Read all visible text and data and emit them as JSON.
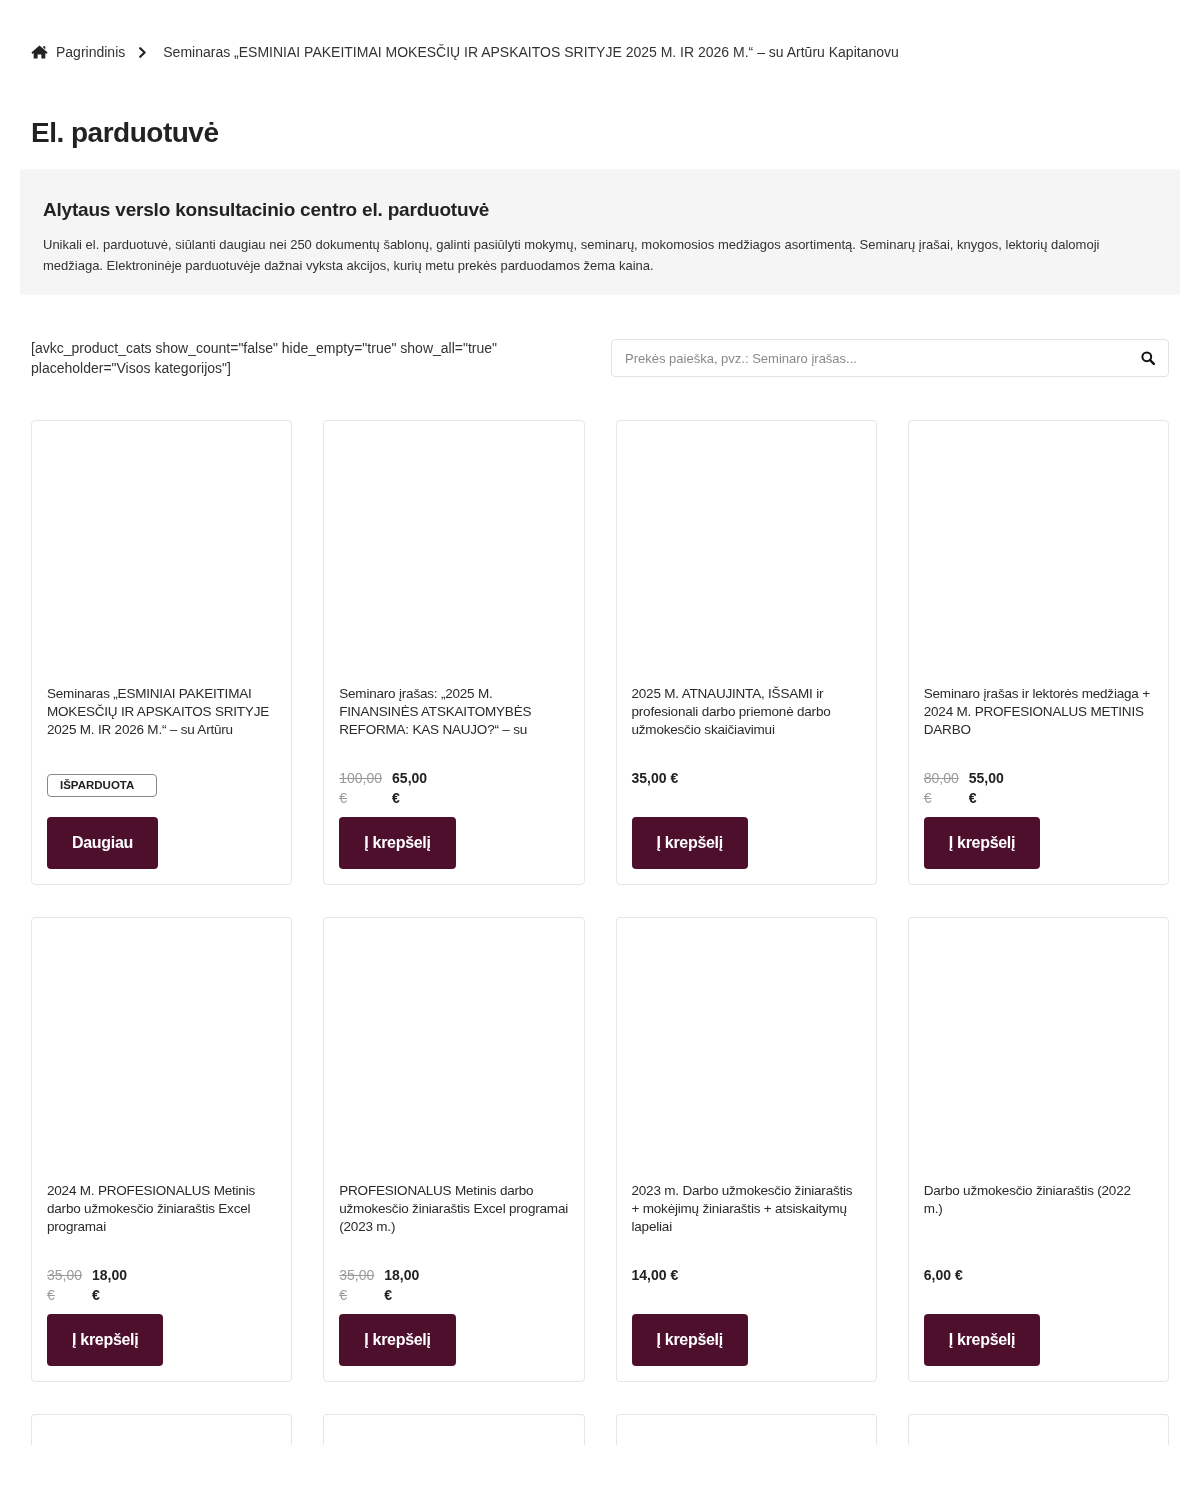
{
  "breadcrumb": [
    {
      "label": "Pagrindinis"
    },
    {
      "label": "Seminaras „ESMINIAI PAKEITIMAI MOKESČIŲ IR APSKAITOS SRITYJE 2025 M. IR 2026 M.“ – su Artūru Kapitanovu"
    }
  ],
  "page_title": "El. parduotuvė",
  "intro": {
    "heading": "Alytaus verslo konsultacinio centro el. parduotuvė",
    "text": "Unikali el. parduotuvė, siūlanti daugiau nei 250 dokumentų šablonų, galinti pasiūlyti mokymų, seminarų, mokomosios medžiagos asortimentą. Seminarų įrašai, knygos, lektorių dalomoji medžiaga. Elektroninėje parduotuvėje dažnai vyksta akcijos, kurių metu prekės parduodamos žema kaina."
  },
  "shortcode_text": "[avkc_product_cats show_count=\"false\" hide_empty=\"true\" show_all=\"true\" placeholder=\"Visos kategorijos\"]",
  "search": {
    "placeholder": "Prekės paieška, pvz.: Seminaro įrašas..."
  },
  "products": [
    {
      "kind": "product",
      "title": "Seminaras „ESMINIAI PAKEITIMAI MOKESČIŲ IR APSKAITOS SRITYJE 2025 M. IR 2026 M.“ – su Artūru",
      "badge": "IŠPARDUOTA",
      "button": "Daugiau"
    },
    {
      "kind": "product",
      "title": "Seminaro įrašas: „2025 M. FINANSINĖS ATSKAITOMYBĖS REFORMA: KAS NAUJO?“ – su",
      "old_price": "100,00 €",
      "price": "65,00 €",
      "button": "Į krepšelį"
    },
    {
      "kind": "product",
      "title": "2025 M. ATNAUJINTA, IŠSAMI ir profesionali darbo priemonė darbo užmokesčio skaičiavimui",
      "price": "35,00 €",
      "button": "Į krepšelį"
    },
    {
      "kind": "product",
      "title": "Seminaro įrašas ir lektorės medžiaga + 2024 M. PROFESIONALUS METINIS DARBO",
      "old_price": "80,00 €",
      "price": "55,00 €",
      "button": "Į krepšelį"
    },
    {
      "kind": "product",
      "title": "2024 M. PROFESIONALUS Metinis darbo užmokesčio žiniaraštis Excel programai",
      "old_price": "35,00 €",
      "price": "18,00 €",
      "button": "Į krepšelį"
    },
    {
      "kind": "product",
      "title": "PROFESIONALUS Metinis darbo užmokesčio žiniaraštis Excel programai (2023 m.)",
      "old_price": "35,00 €",
      "price": "18,00 €",
      "button": "Į krepšelį"
    },
    {
      "kind": "product",
      "title": "2023 m. Darbo užmokesčio žiniaraštis + mokėjimų žiniaraštis + atsiskaitymų lapeliai",
      "price": "14,00 €",
      "button": "Į krepšelį"
    },
    {
      "kind": "product",
      "title": "Darbo užmokesčio žiniaraštis (2022 m.)",
      "price": "6,00 €",
      "button": "Į krepšelį"
    },
    {
      "kind": "cut-off"
    },
    {
      "kind": "cut-off"
    },
    {
      "kind": "cut-off"
    },
    {
      "kind": "cut-off"
    }
  ]
}
